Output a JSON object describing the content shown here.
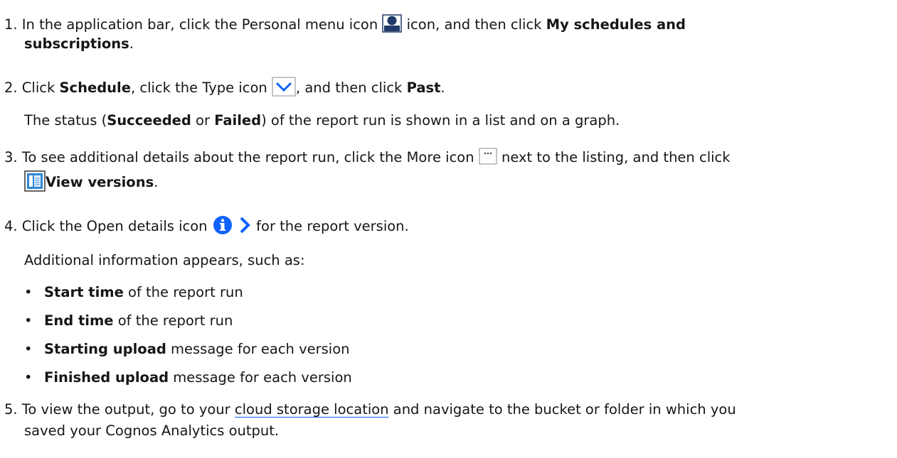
{
  "steps": [
    {
      "num": "1.",
      "t1": " In the application bar, click the Personal menu icon ",
      "t2": " icon, and then click ",
      "b1": "My schedules and",
      "b2": "subscriptions",
      "t3": ".",
      "icon": "personal-menu-icon"
    },
    {
      "num": "2.",
      "t1": " Click ",
      "b1": "Schedule",
      "t2": ", click the Type icon ",
      "t3": ", and then click ",
      "b2": "Past",
      "t4": ".",
      "icon": "chevron-down-icon",
      "note_pre": "The status (",
      "note_b1": "Succeeded",
      "note_mid": " or ",
      "note_b2": "Failed",
      "note_post": ") of the report run is shown in a list and on a graph."
    },
    {
      "num": "3.",
      "t1": " To see additional details about the report run, click the More icon ",
      "t2": " next to the listing, and then click",
      "b1": "View versions",
      "t3": ".",
      "icons": [
        "more-icon",
        "view-versions-icon"
      ]
    },
    {
      "num": "4.",
      "t1": " Click the Open details icon ",
      "t2": " for the report version.",
      "icons": [
        "info-icon",
        "chevron-right-icon"
      ],
      "note": "Additional information appears, such as:",
      "bullets": [
        {
          "bold": "Start time",
          "rest": " of the report run"
        },
        {
          "bold": "End time",
          "rest": " of the report run"
        },
        {
          "bold": "Starting upload",
          "rest": " message for each version"
        },
        {
          "bold": "Finished upload",
          "rest": " message for each version"
        }
      ]
    },
    {
      "num": "5.",
      "t1": " To view the output, go to your ",
      "link": "cloud storage location",
      "t2": " and navigate to the bucket or folder in which you",
      "line2": "saved your Cognos Analytics output."
    }
  ],
  "bullet_char": "•",
  "colors": {
    "text": "#161616",
    "icon_blue": "#0f62fe",
    "personal_icon": "#1f3a66",
    "link_underline": "#0f62fe"
  }
}
